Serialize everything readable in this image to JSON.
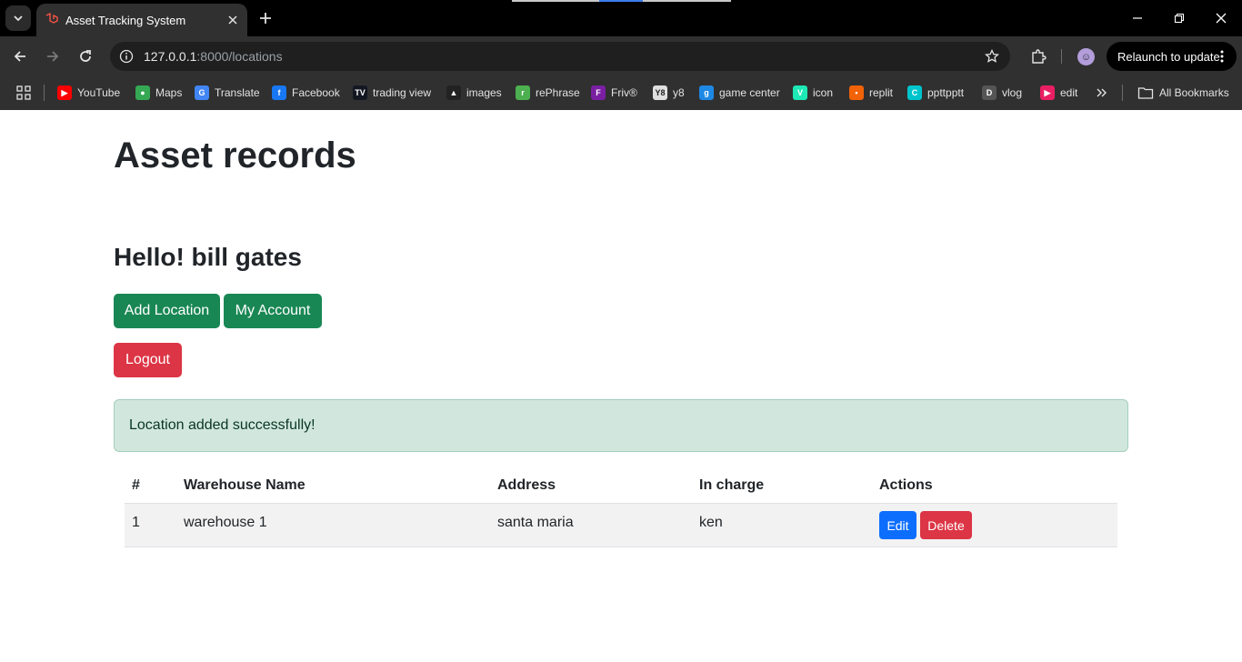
{
  "browser": {
    "tab_title": "Asset Tracking System",
    "url_host": "127.0.0.1",
    "url_path": ":8000/locations",
    "relaunch_label": "Relaunch to update",
    "bookmarks": [
      {
        "label": "YouTube",
        "icon": "youtube-icon",
        "color": "#ff0000",
        "glyph": "▶"
      },
      {
        "label": "Maps",
        "icon": "maps-icon",
        "color": "#34a853",
        "glyph": "●"
      },
      {
        "label": "Translate",
        "icon": "translate-icon",
        "color": "#4285f4",
        "glyph": "G"
      },
      {
        "label": "Facebook",
        "icon": "facebook-icon",
        "color": "#1877f2",
        "glyph": "f"
      },
      {
        "label": "trading view",
        "icon": "tradingview-icon",
        "color": "#131722",
        "glyph": "TV"
      },
      {
        "label": "images",
        "icon": "images-icon",
        "color": "#222222",
        "glyph": "▲"
      },
      {
        "label": "rePhrase",
        "icon": "rephrase-icon",
        "color": "#4caf50",
        "glyph": "r"
      },
      {
        "label": "Friv®",
        "icon": "friv-icon",
        "color": "#7b1fa2",
        "glyph": "F"
      },
      {
        "label": "y8",
        "icon": "y8-icon",
        "color": "#e0e0e0",
        "glyph": "Y8"
      },
      {
        "label": "game center",
        "icon": "game-center-icon",
        "color": "#1e88e5",
        "glyph": "g"
      },
      {
        "label": "icon",
        "icon": "vuetify-icon",
        "color": "#1de9b6",
        "glyph": "V"
      },
      {
        "label": "replit",
        "icon": "replit-icon",
        "color": "#f26207",
        "glyph": "▪"
      },
      {
        "label": "ppttpptt",
        "icon": "canva-icon",
        "color": "#00c4cc",
        "glyph": "C"
      },
      {
        "label": "vlog",
        "icon": "vlog-icon",
        "color": "#555555",
        "glyph": "D"
      },
      {
        "label": "edit",
        "icon": "edit-play-icon",
        "color": "#e91e63",
        "glyph": "▶"
      }
    ],
    "all_bookmarks_label": "All Bookmarks"
  },
  "page": {
    "title": "Asset records",
    "greeting": "Hello! bill gates",
    "buttons": {
      "add_location": "Add Location",
      "my_account": "My Account",
      "logout": "Logout"
    },
    "alert": "Location added successfully!",
    "table": {
      "headers": [
        "#",
        "Warehouse Name",
        "Address",
        "In charge",
        "Actions"
      ],
      "rows": [
        {
          "id": "1",
          "warehouse": "warehouse 1",
          "address": "santa maria",
          "in_charge": "ken",
          "edit": "Edit",
          "delete": "Delete"
        }
      ]
    }
  },
  "colors": {
    "success": "#198754",
    "danger": "#dc3545",
    "primary": "#0d6efd",
    "alert_bg": "#d1e7dd"
  }
}
